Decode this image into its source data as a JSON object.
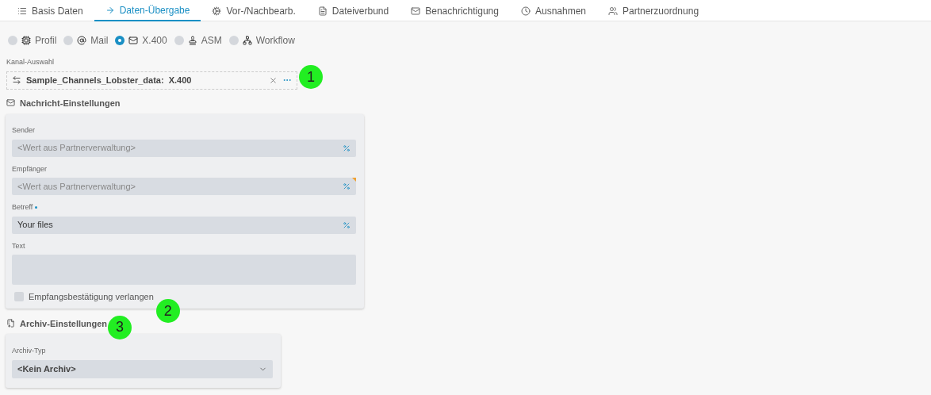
{
  "tabs": [
    {
      "label": "Basis Daten",
      "selected": false
    },
    {
      "label": "Daten-Übergabe",
      "selected": true
    },
    {
      "label": "Vor-/Nachbearb.",
      "selected": false
    },
    {
      "label": "Dateiverbund",
      "selected": false
    },
    {
      "label": "Benachrichtigung",
      "selected": false
    },
    {
      "label": "Ausnahmen",
      "selected": false
    },
    {
      "label": "Partnerzuordnung",
      "selected": false
    }
  ],
  "channel_types": [
    {
      "label": "Profil",
      "selected": false
    },
    {
      "label": "Mail",
      "selected": false
    },
    {
      "label": "X.400",
      "selected": true
    },
    {
      "label": "ASM",
      "selected": false
    },
    {
      "label": "Workflow",
      "selected": false
    }
  ],
  "channel_select": {
    "label": "Kanal-Auswahl",
    "value": "Sample_Channels_Lobster_data:  X.400",
    "callout": "1"
  },
  "message_settings": {
    "title": "Nachricht-Einstellungen",
    "fields": [
      {
        "label": "Sender",
        "placeholder": "<Wert aus Partnerverwaltung>",
        "required": false,
        "flagged": false,
        "kind": "variable"
      },
      {
        "label": "Empfänger",
        "placeholder": "<Wert aus Partnerverwaltung>",
        "required": false,
        "flagged": true,
        "kind": "variable"
      },
      {
        "label": "Betreff",
        "value": "Your files",
        "required": true,
        "flagged": false,
        "kind": "variable"
      },
      {
        "label": "Text",
        "required": false,
        "flagged": false,
        "kind": "textarea"
      }
    ],
    "receipt": {
      "label": "Empfangsbestätigung verlangen",
      "checked": false,
      "callout": "2"
    }
  },
  "archive_settings": {
    "title": "Archiv-Einstellungen",
    "callout": "3",
    "type_label": "Archiv-Typ",
    "type_value": "<Kein Archiv>"
  }
}
